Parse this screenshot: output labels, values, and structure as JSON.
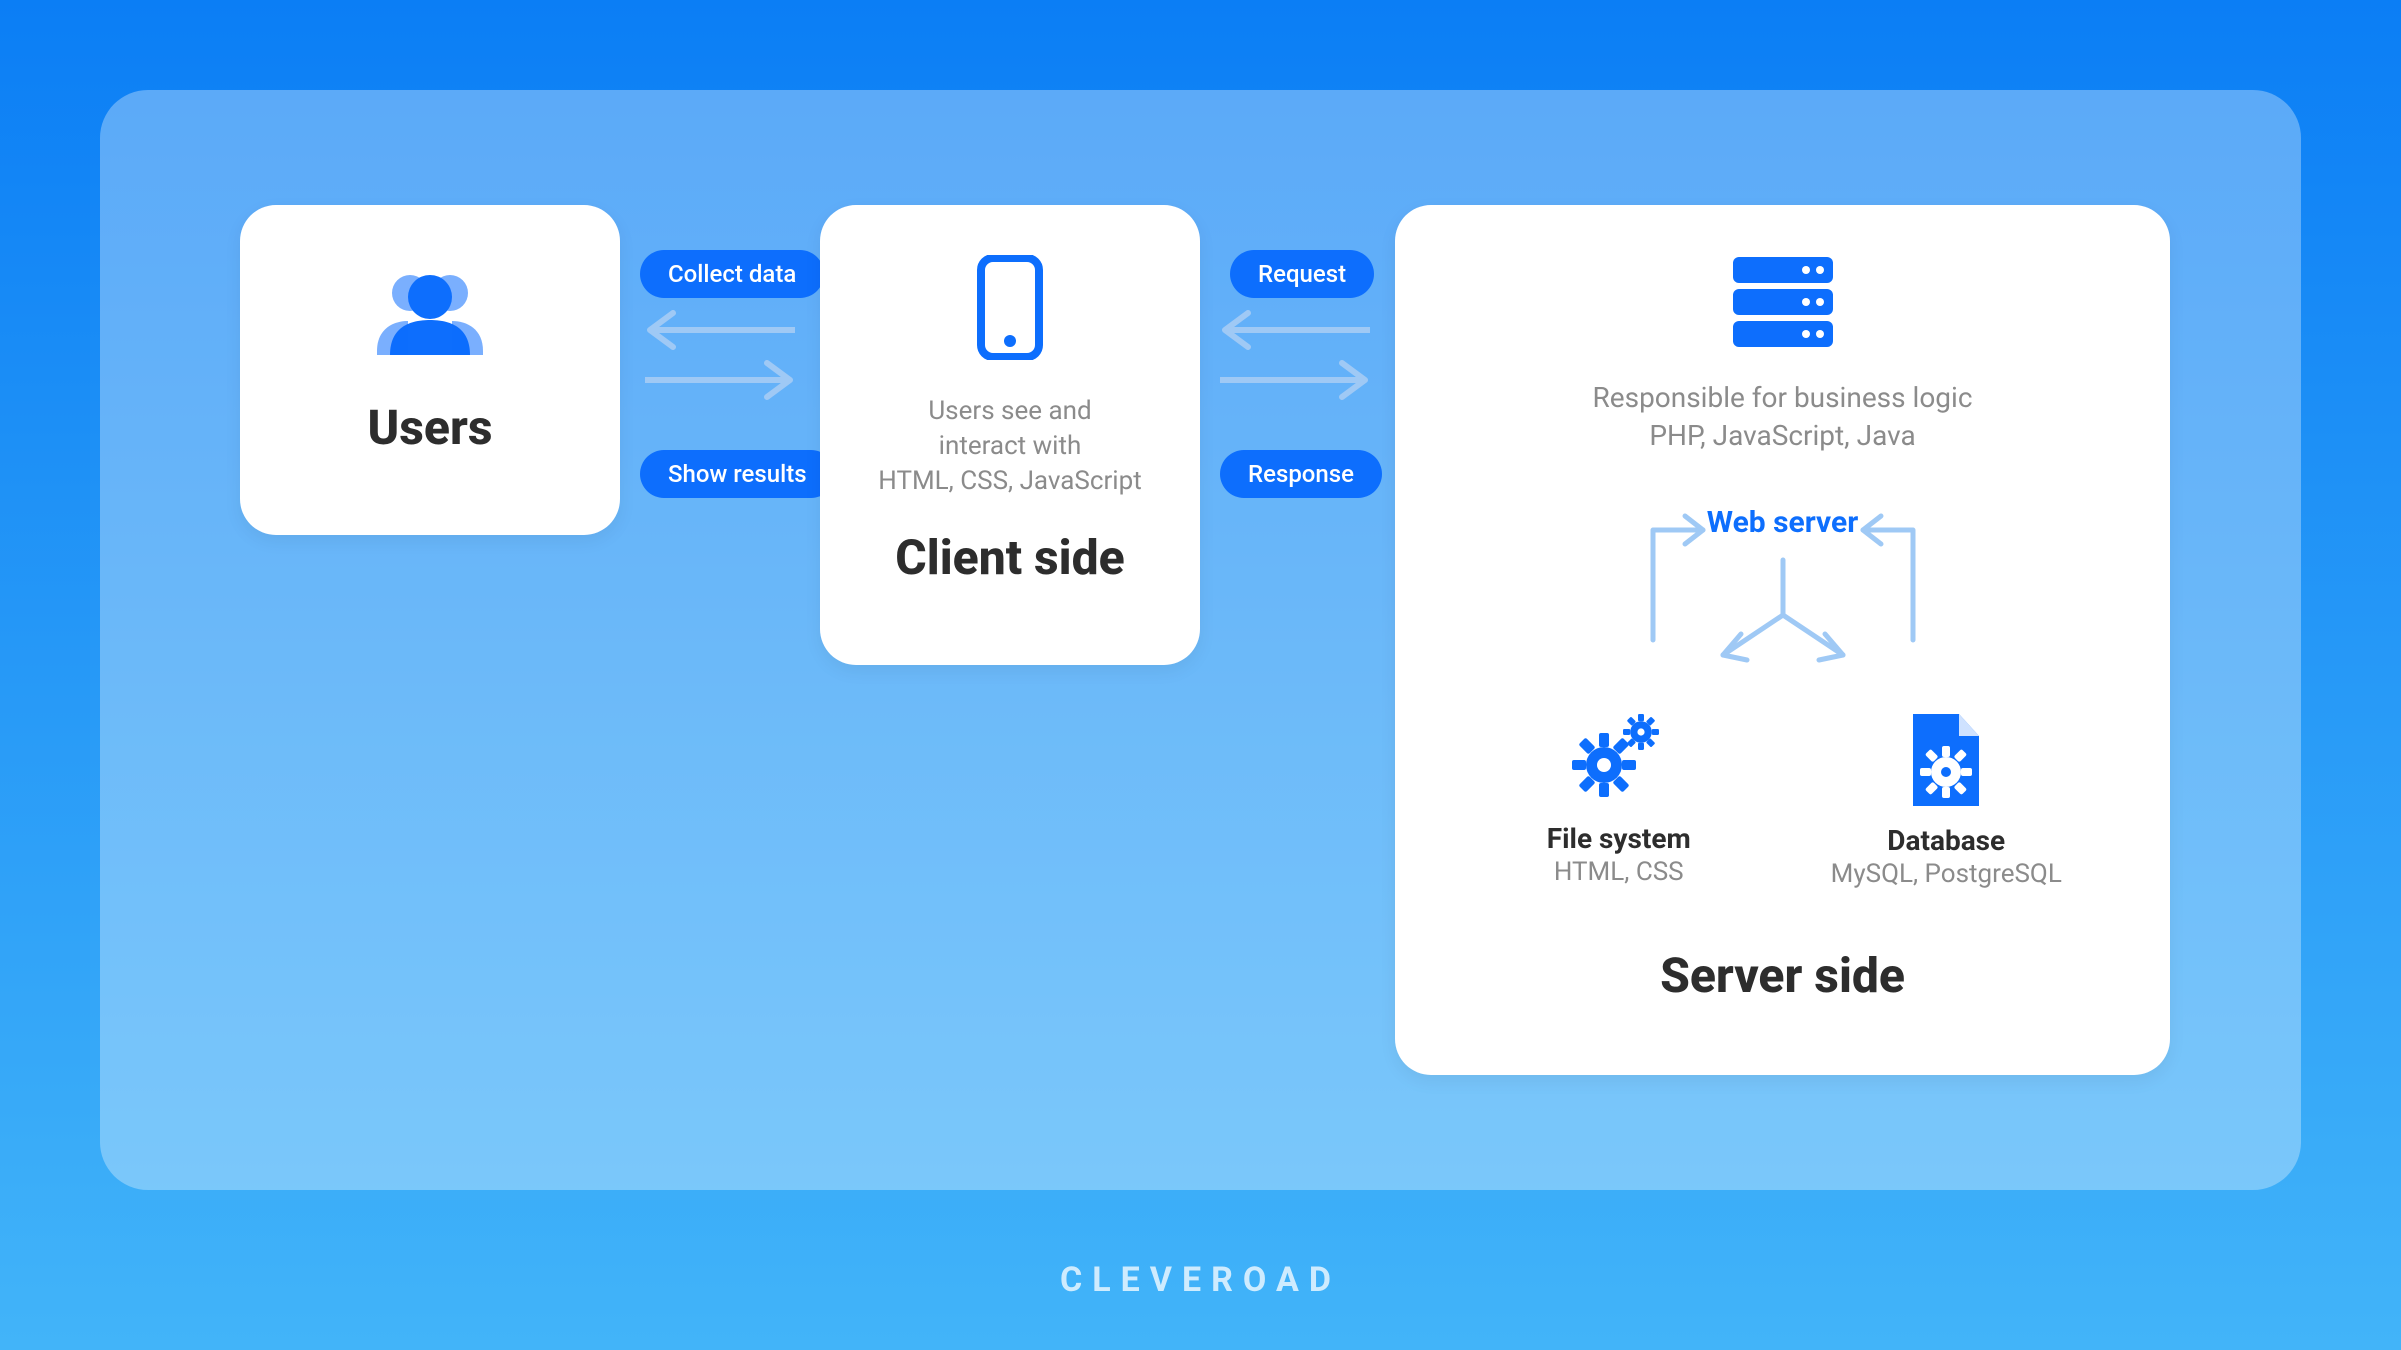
{
  "users": {
    "title": "Users"
  },
  "connector1": {
    "top": "Collect data",
    "bottom": "Show results"
  },
  "client": {
    "desc_line1": "Users see and",
    "desc_line2": "interact with",
    "tech": "HTML, CSS, JavaScript",
    "title": "Client side"
  },
  "connector2": {
    "top": "Request",
    "bottom": "Response"
  },
  "server": {
    "desc": "Responsible for business logic",
    "tech": "PHP, JavaScript, Java",
    "web_label": "Web server",
    "filesystem": {
      "title": "File system",
      "tech": "HTML, CSS"
    },
    "database": {
      "title": "Database",
      "tech": "MySQL, PostgreSQL"
    },
    "title": "Server side"
  },
  "brand": "CLEVEROAD"
}
